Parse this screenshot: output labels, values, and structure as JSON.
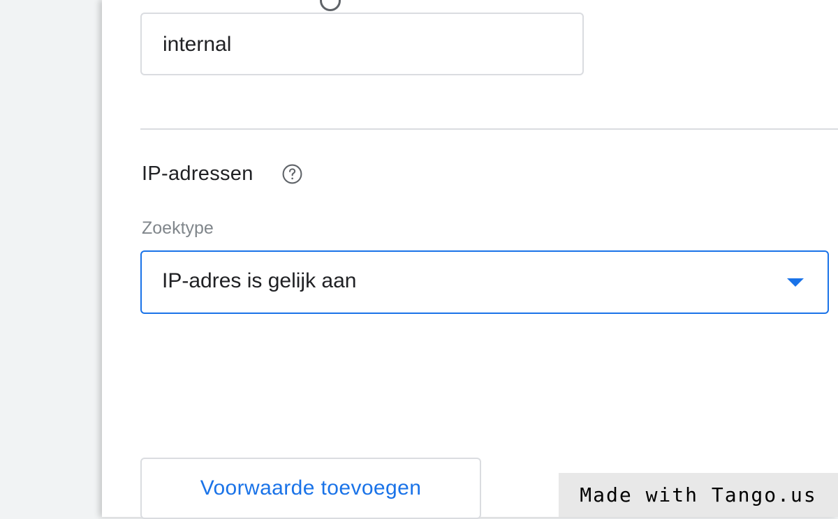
{
  "form": {
    "name_field": {
      "value": "internal"
    },
    "ip_section": {
      "title": "IP-adressen",
      "help_icon": "help-circle-icon",
      "search_type_label": "Zoektype",
      "search_type_value": "IP-adres is gelijk aan",
      "dropdown_icon": "caret-down-icon"
    },
    "add_condition_label": "Voorwaarde toevoegen"
  },
  "watermark": {
    "text": "Made with Tango.us"
  },
  "colors": {
    "accent": "#1a73e8",
    "border": "#dadce0",
    "muted_text": "#80868b",
    "background": "#f1f3f4"
  }
}
